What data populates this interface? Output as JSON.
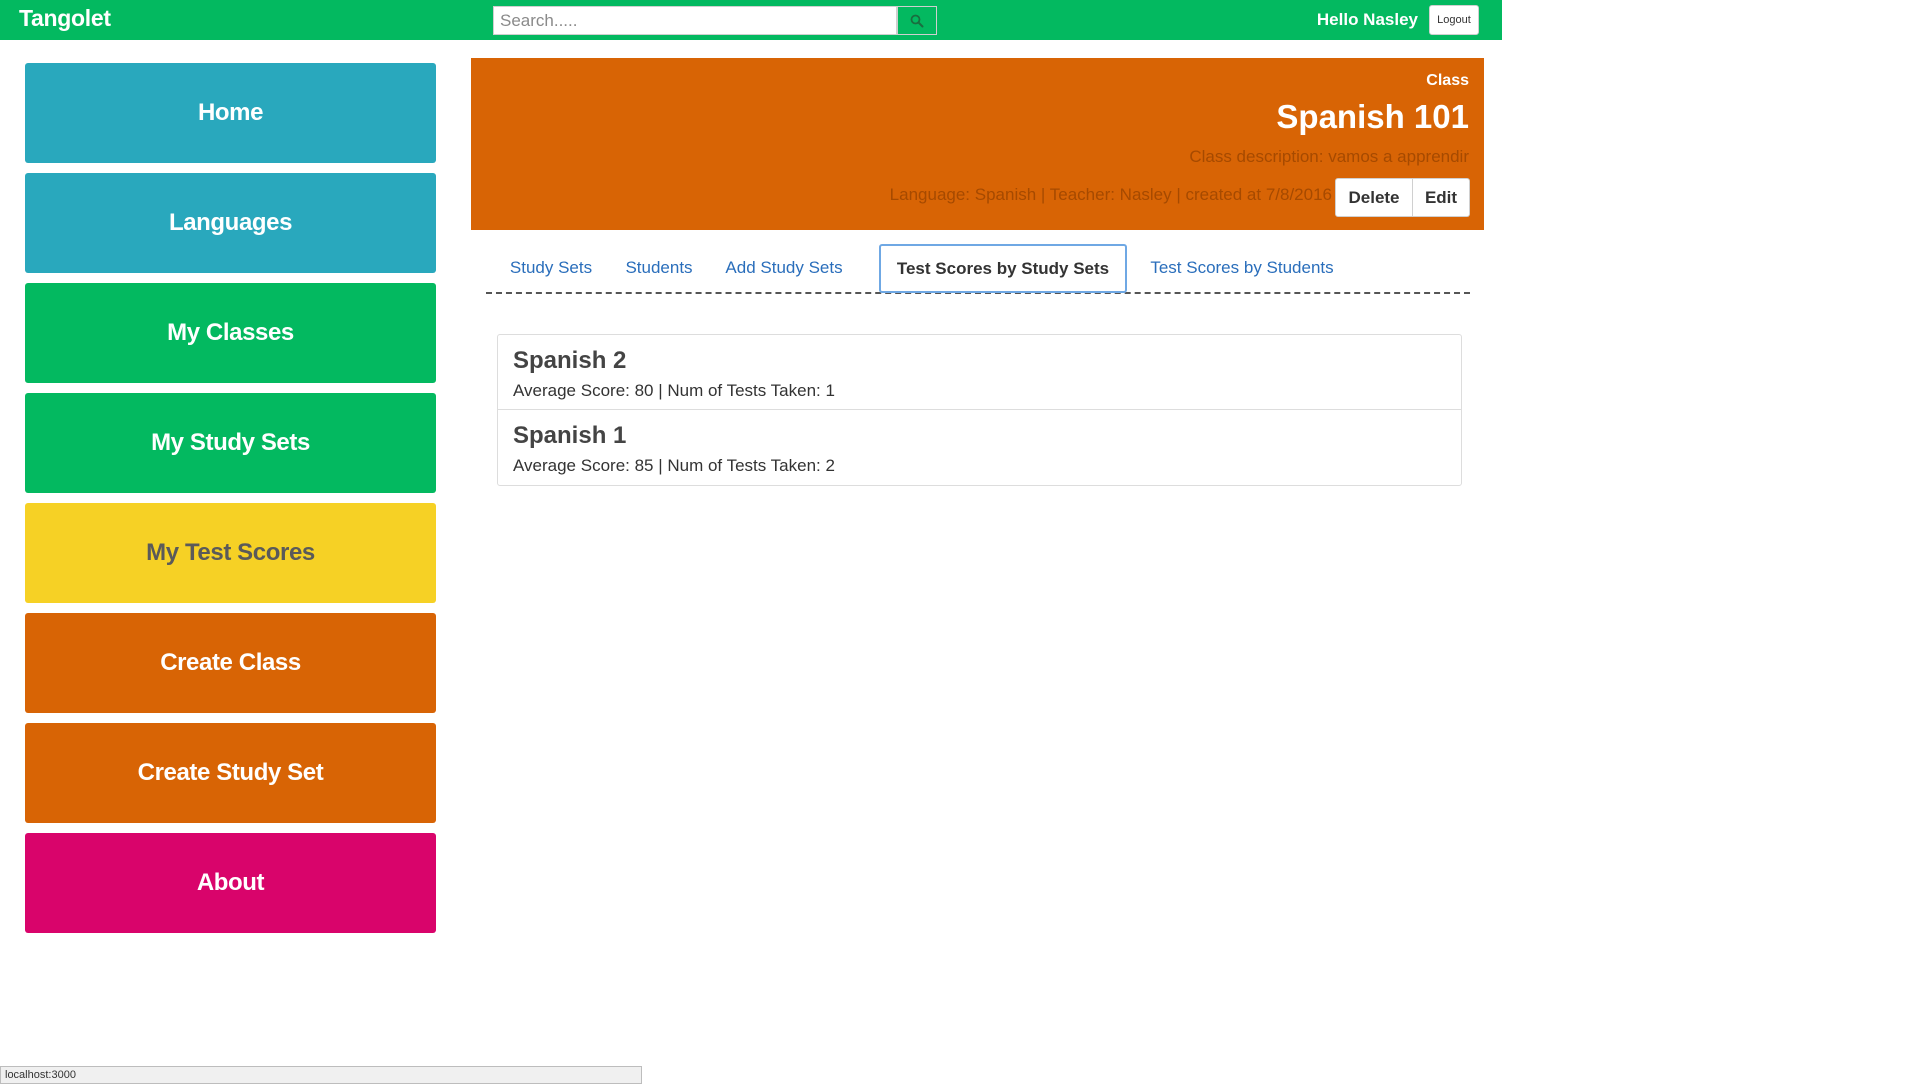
{
  "navbar": {
    "brand": "Tangolet",
    "search_placeholder": "Search.....",
    "search_value": "",
    "search_icon": "search-icon",
    "greeting": "Hello Nasley",
    "logout_label": "Logout",
    "color": "#03b960"
  },
  "sidebar": {
    "items": [
      {
        "label": "Home",
        "color": "#29a8bd"
      },
      {
        "label": "Languages",
        "color": "#29a8bd"
      },
      {
        "label": "My Classes",
        "color": "#03b960"
      },
      {
        "label": "My Study Sets",
        "color": "#03b960"
      },
      {
        "label": "My Test Scores",
        "color": "#f6d125"
      },
      {
        "label": "Create Class",
        "color": "#d86405"
      },
      {
        "label": "Create Study Set",
        "color": "#d86405"
      },
      {
        "label": "About",
        "color": "#d9046b"
      }
    ]
  },
  "class_header": {
    "label": "Class",
    "title": "Spanish 101",
    "description": "Class description: vamos a apprendir",
    "meta": "Language: Spanish | Teacher: Nasley | created at 7/8/2016",
    "delete_label": "Delete",
    "edit_label": "Edit",
    "color": "#d86405"
  },
  "tabs": [
    {
      "label": "Study Sets",
      "active": false
    },
    {
      "label": "Students",
      "active": false
    },
    {
      "label": "Add Study Sets",
      "active": false
    },
    {
      "label": "Test Scores by Study Sets",
      "active": true
    },
    {
      "label": "Test Scores by Students",
      "active": false
    }
  ],
  "scores": [
    {
      "title": "Spanish 2",
      "detail": "Average Score: 80 | Num of Tests Taken: 1"
    },
    {
      "title": "Spanish 1",
      "detail": "Average Score: 85 | Num of Tests Taken: 2"
    }
  ],
  "status_bar": {
    "url": "localhost:3000"
  }
}
